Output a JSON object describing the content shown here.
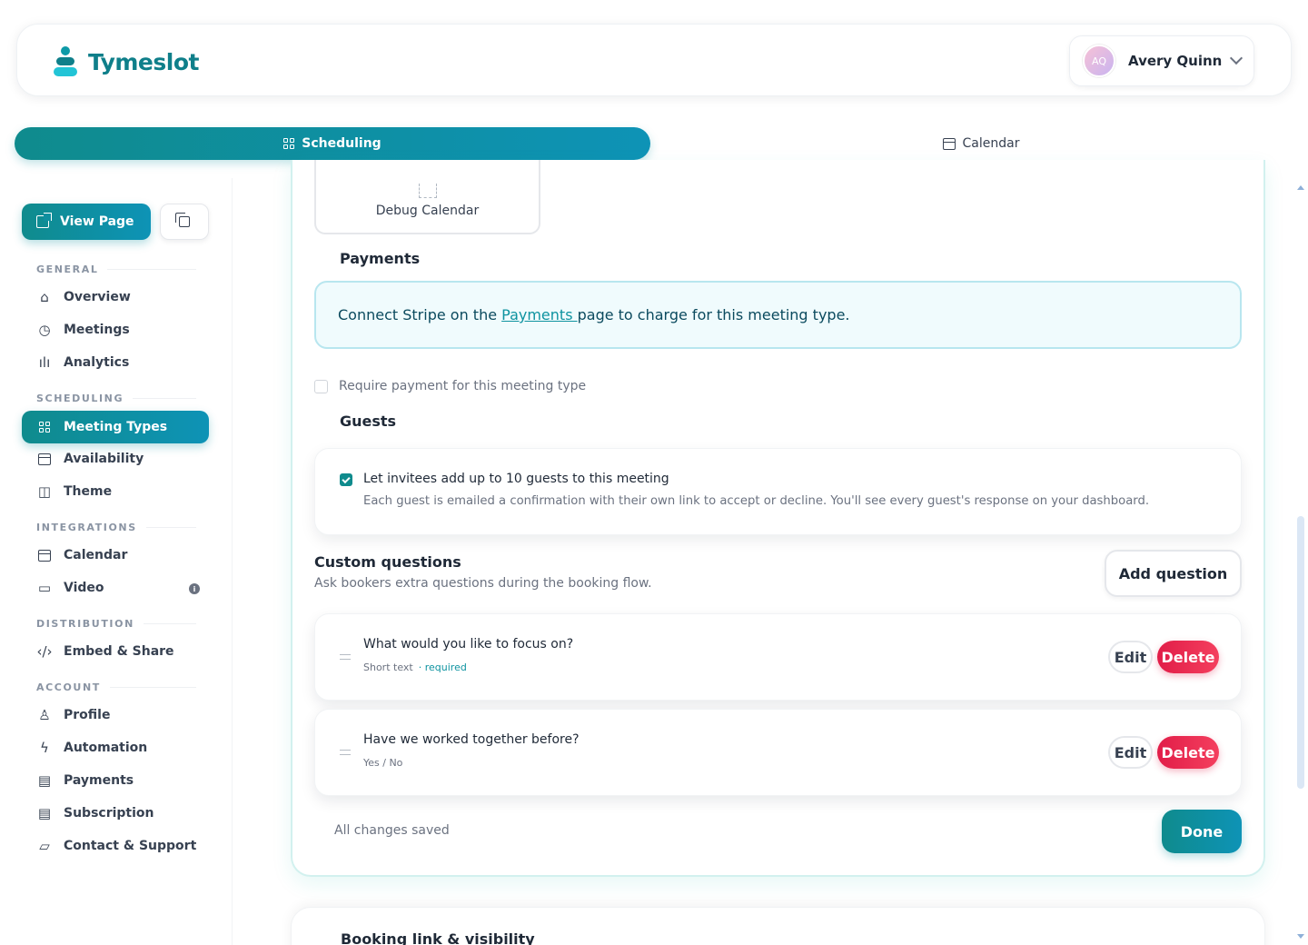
{
  "app": {
    "name": "Tymeslot"
  },
  "user": {
    "name": "Avery Quinn",
    "initials": "AQ"
  },
  "top_tabs": [
    {
      "label": "Scheduling",
      "icon": "grid-icon",
      "active": true
    },
    {
      "label": "Calendar",
      "icon": "calendar-icon",
      "active": false
    }
  ],
  "sidebar": {
    "view_page_label": "View Page",
    "sections": [
      {
        "label": "GENERAL",
        "items": [
          "Overview",
          "Meetings",
          "Analytics"
        ]
      },
      {
        "label": "SCHEDULING",
        "items": [
          "Meeting Types",
          "Availability",
          "Theme"
        ]
      },
      {
        "label": "INTEGRATIONS",
        "items": [
          "Calendar",
          "Video"
        ]
      },
      {
        "label": "DISTRIBUTION",
        "items": [
          "Embed & Share"
        ]
      },
      {
        "label": "ACCOUNT",
        "items": [
          "Profile",
          "Automation",
          "Payments",
          "Subscription",
          "Contact & Support"
        ]
      }
    ],
    "active_item": "Meeting Types"
  },
  "main": {
    "debug_calendar_label": "Debug Calendar",
    "payments": {
      "heading": "Payments",
      "notice_prefix": "Connect Stripe on the ",
      "notice_link": "Payments ",
      "notice_suffix": "page to charge for this meeting type.",
      "require_payment_label": "Require payment for this meeting type",
      "require_payment_checked": false
    },
    "guests": {
      "heading": "Guests",
      "toggle_label": "Let invitees add up to 10 guests to this meeting",
      "toggle_checked": true,
      "description": "Each guest is emailed a confirmation with their own link to accept or decline. You'll see every guest's response on your dashboard."
    },
    "custom_questions": {
      "heading": "Custom questions",
      "subheading": "Ask bookers extra questions during the booking flow.",
      "add_label": "Add question",
      "edit_label": "Edit",
      "delete_label": "Delete",
      "questions": [
        {
          "label": "What would you like to focus on?",
          "type": "Short text",
          "required_text": "· required"
        },
        {
          "label": "Have we worked together before?",
          "type": "Yes / No",
          "required_text": ""
        }
      ]
    },
    "status_text": "All changes saved",
    "done_label": "Done",
    "next_section_heading": "Booking link & visibility"
  },
  "colors": {
    "brand": "#0f8b8d",
    "brand_gradient_end": "#0e93b6",
    "danger": "#e11d48",
    "notice_bg": "#f0fbfd"
  }
}
